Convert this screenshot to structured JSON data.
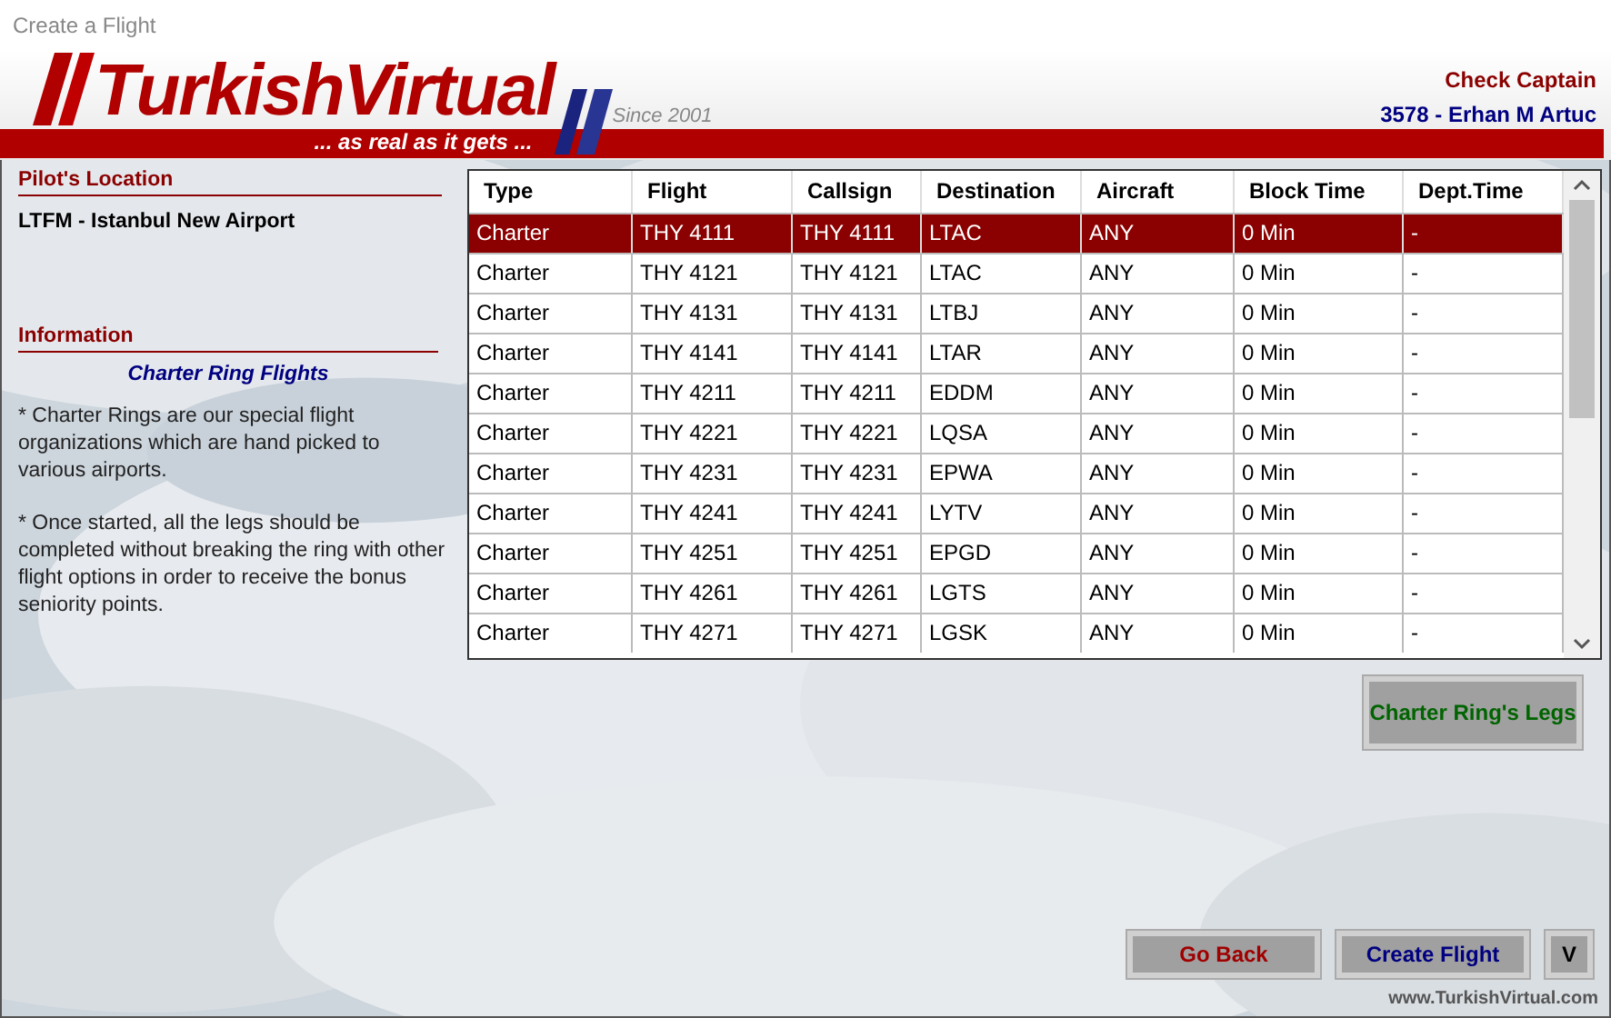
{
  "window": {
    "title": "Create a Flight"
  },
  "header": {
    "logo": "TurkishVirtual",
    "slogan": "... as real as it gets ...",
    "since": "Since 2001",
    "rank": "Check Captain",
    "pilot": "3578 - Erhan M Artuc"
  },
  "pilot_location": {
    "heading": "Pilot's Location",
    "value": "LTFM - Istanbul New Airport"
  },
  "information": {
    "heading": "Information",
    "title": "Charter Ring Flights",
    "paragraphs": [
      "* Charter Rings are our special flight organizations which are hand picked to various airports.",
      "* Once started, all the legs should be completed without breaking the ring with other flight options in order to receive the bonus seniority points."
    ]
  },
  "table": {
    "columns": [
      "Type",
      "Flight",
      "Callsign",
      "Destination",
      "Aircraft",
      "Block Time",
      "Dept.Time"
    ],
    "rows": [
      {
        "selected": true,
        "cells": [
          "Charter",
          "THY 4111",
          "THY 4111",
          "LTAC",
          "ANY",
          "0 Min",
          "-"
        ]
      },
      {
        "selected": false,
        "cells": [
          "Charter",
          "THY 4121",
          "THY 4121",
          "LTAC",
          "ANY",
          "0 Min",
          "-"
        ]
      },
      {
        "selected": false,
        "cells": [
          "Charter",
          "THY 4131",
          "THY 4131",
          "LTBJ",
          "ANY",
          "0 Min",
          "-"
        ]
      },
      {
        "selected": false,
        "cells": [
          "Charter",
          "THY 4141",
          "THY 4141",
          "LTAR",
          "ANY",
          "0 Min",
          "-"
        ]
      },
      {
        "selected": false,
        "cells": [
          "Charter",
          "THY 4211",
          "THY 4211",
          "EDDM",
          "ANY",
          "0 Min",
          "-"
        ]
      },
      {
        "selected": false,
        "cells": [
          "Charter",
          "THY 4221",
          "THY 4221",
          "LQSA",
          "ANY",
          "0 Min",
          "-"
        ]
      },
      {
        "selected": false,
        "cells": [
          "Charter",
          "THY 4231",
          "THY 4231",
          "EPWA",
          "ANY",
          "0 Min",
          "-"
        ]
      },
      {
        "selected": false,
        "cells": [
          "Charter",
          "THY 4241",
          "THY 4241",
          "LYTV",
          "ANY",
          "0 Min",
          "-"
        ]
      },
      {
        "selected": false,
        "cells": [
          "Charter",
          "THY 4251",
          "THY 4251",
          "EPGD",
          "ANY",
          "0 Min",
          "-"
        ]
      },
      {
        "selected": false,
        "cells": [
          "Charter",
          "THY 4261",
          "THY 4261",
          "LGTS",
          "ANY",
          "0 Min",
          "-"
        ]
      },
      {
        "selected": false,
        "cells": [
          "Charter",
          "THY 4271",
          "THY 4271",
          "LGSK",
          "ANY",
          "0 Min",
          "-"
        ]
      }
    ]
  },
  "legs_button": "Charter Ring's Legs",
  "buttons": [
    {
      "label": "Go Back",
      "kind": "back"
    },
    {
      "label": "Create Flight",
      "kind": "create"
    },
    {
      "label": "V",
      "kind": "small"
    }
  ],
  "footer": "www.TurkishVirtual.com"
}
